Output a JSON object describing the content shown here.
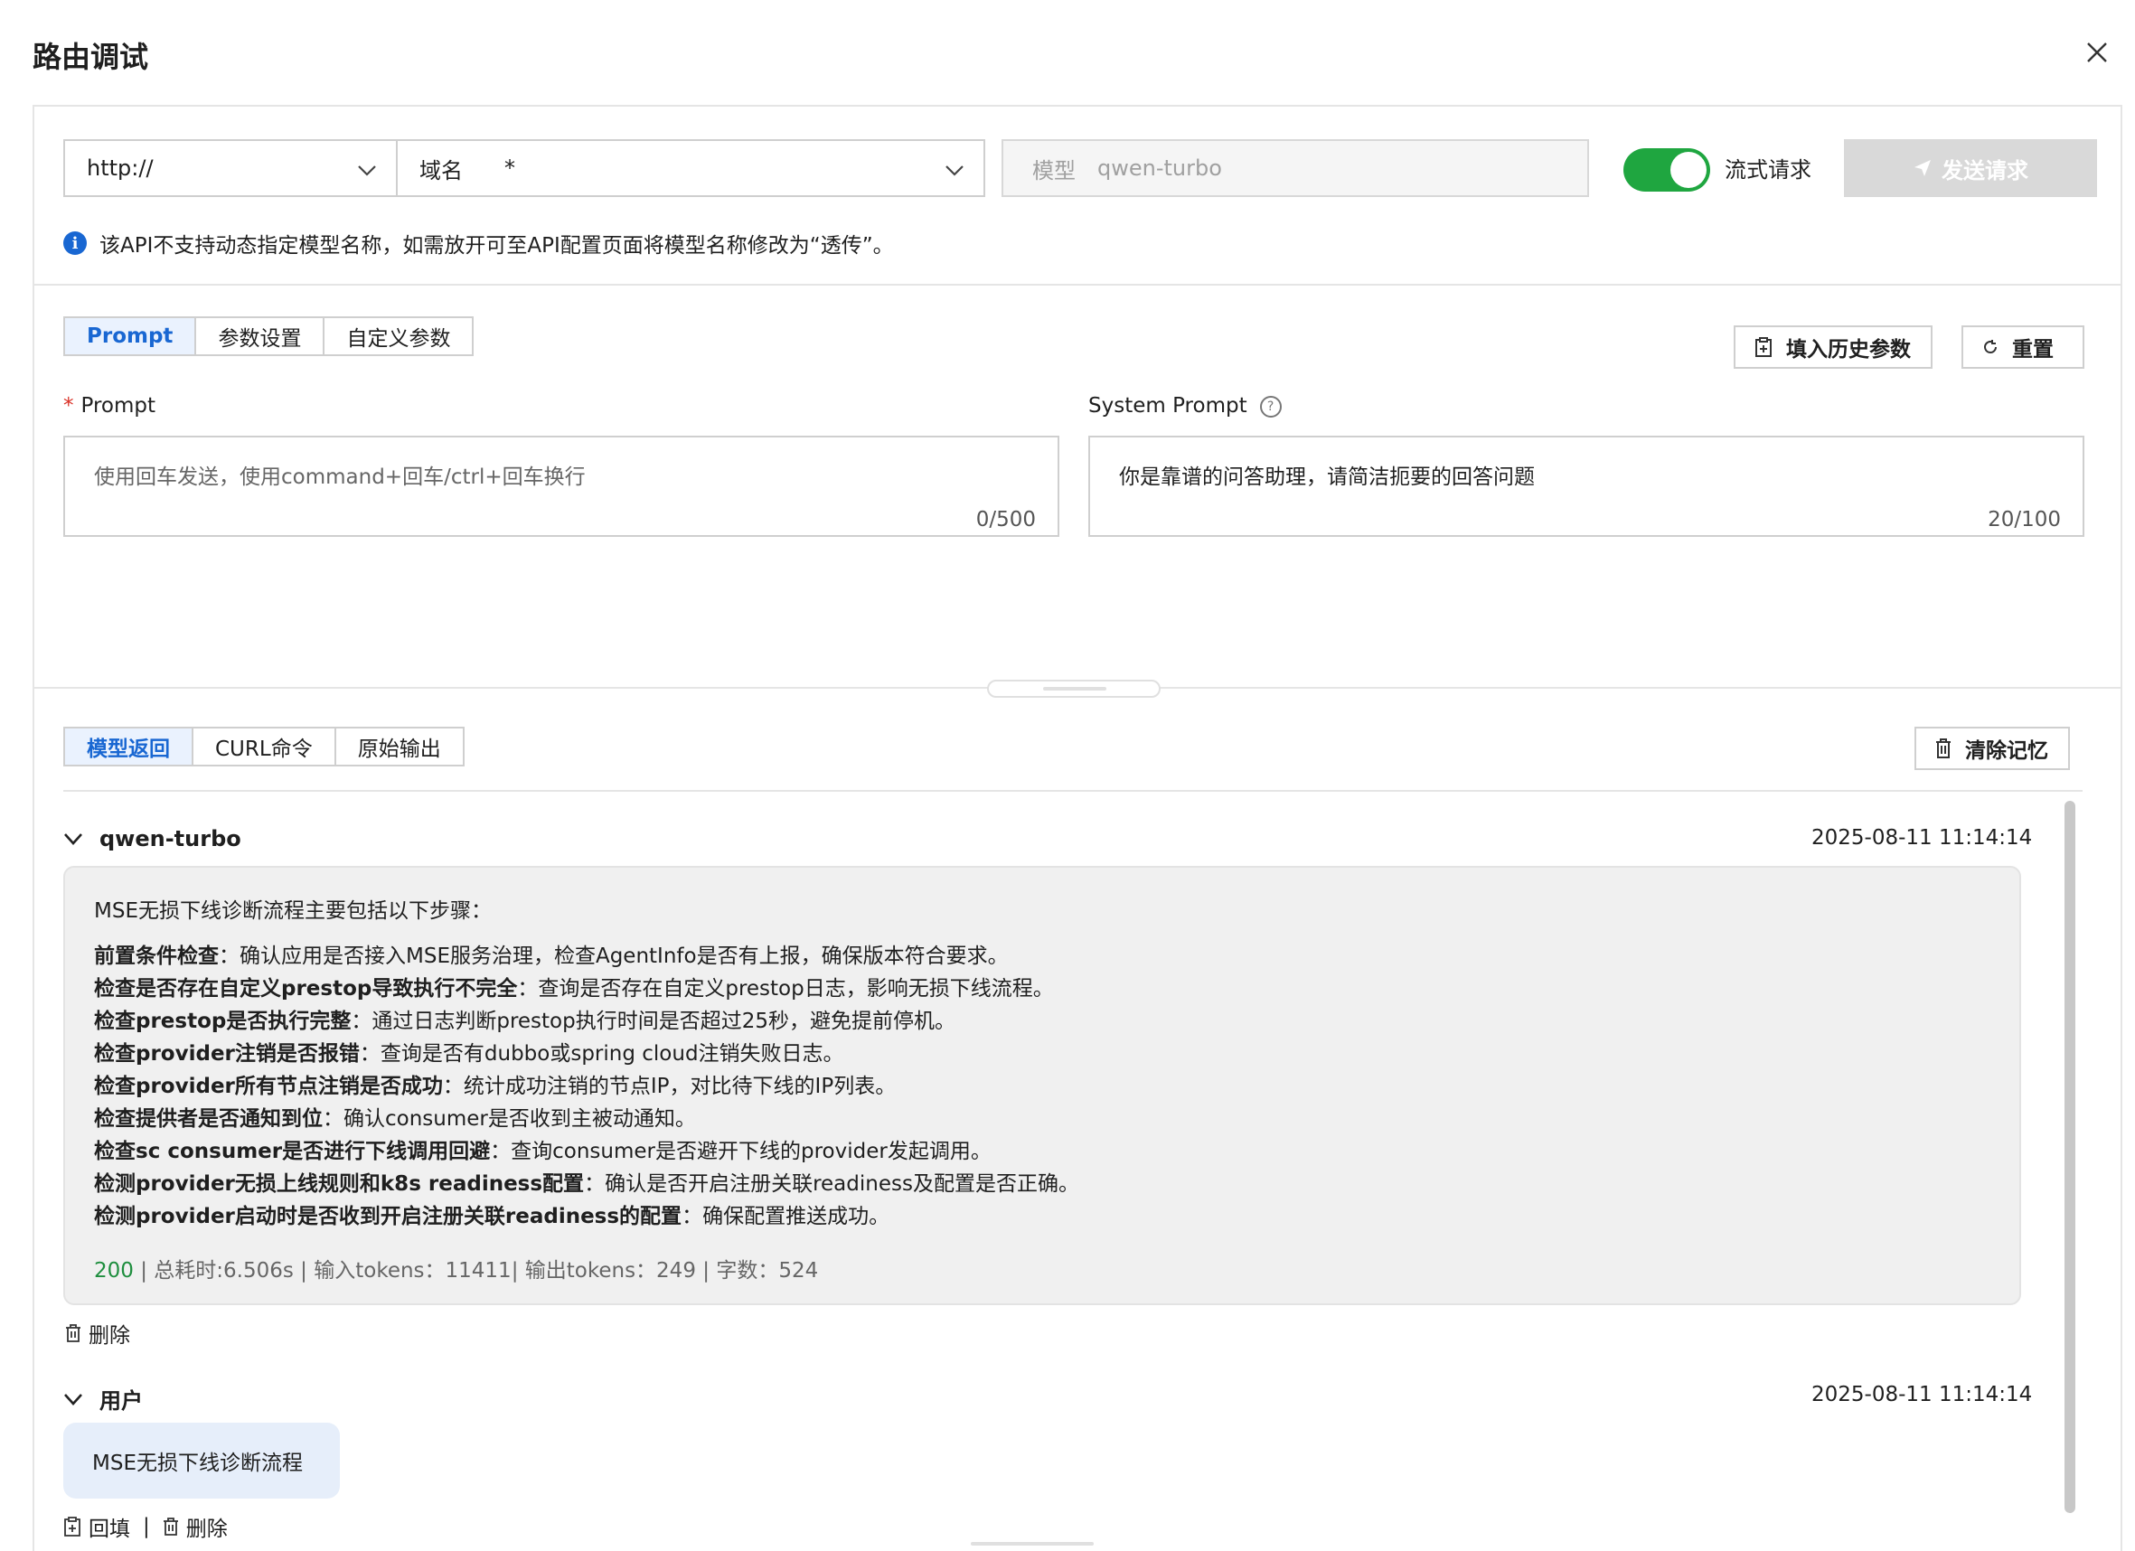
{
  "dialog": {
    "title": "路由调试"
  },
  "request": {
    "protocol": "http://",
    "domain_label": "域名",
    "domain_value": "*",
    "model_label": "模型",
    "model_value": "qwen-turbo",
    "stream_label": "流式请求",
    "send_label": "发送请求",
    "info_text": "该API不支持动态指定模型名称，如需放开可至API配置页面将模型名称修改为“透传”。"
  },
  "prompt_tabs": [
    "Prompt",
    "参数设置",
    "自定义参数"
  ],
  "actions": {
    "fill_history": "填入历史参数",
    "reset": "重置"
  },
  "prompt": {
    "label": "Prompt",
    "placeholder": "使用回车发送，使用command+回车/ctrl+回车换行",
    "count": "0/500"
  },
  "system_prompt": {
    "label": "System Prompt",
    "value": "你是靠谱的问答助理，请简洁扼要的回答问题",
    "count": "20/100"
  },
  "output_tabs": [
    "模型返回",
    "CURL命令",
    "原始输出"
  ],
  "clear_memory": "清除记忆",
  "response": {
    "model": "qwen-turbo",
    "time": "2025-08-11 11:14:14",
    "intro": "MSE无损下线诊断流程主要包括以下步骤：",
    "steps": [
      {
        "title": "前置条件检查",
        "desc": "：确认应用是否接入MSE服务治理，检查AgentInfo是否有上报，确保版本符合要求。"
      },
      {
        "title": "检查是否存在自定义prestop导致执行不完全",
        "desc": "：查询是否存在自定义prestop日志，影响无损下线流程。"
      },
      {
        "title": "检查prestop是否执行完整",
        "desc": "：通过日志判断prestop执行时间是否超过25秒，避免提前停机。"
      },
      {
        "title": "检查provider注销是否报错",
        "desc": "：查询是否有dubbo或spring cloud注销失败日志。"
      },
      {
        "title": "检查provider所有节点注销是否成功",
        "desc": "：统计成功注销的节点IP，对比待下线的IP列表。"
      },
      {
        "title": "检查提供者是否通知到位",
        "desc": "：确认consumer是否收到主被动通知。"
      },
      {
        "title": "检查sc consumer是否进行下线调用回避",
        "desc": "：查询consumer是否避开下线的provider发起调用。"
      },
      {
        "title": "检测provider无损上线规则和k8s readiness配置",
        "desc": "：确认是否开启注册关联readiness及配置是否正确。"
      },
      {
        "title": "检测provider启动时是否收到开启注册关联readiness的配置",
        "desc": "：确保配置推送成功。"
      }
    ],
    "status": "200",
    "stats": " | 总耗时:6.506s | 输入tokens：11411| 输出tokens：249 | 字数：524",
    "delete_label": "删除"
  },
  "user_message": {
    "label": "用户",
    "time": "2025-08-11 11:14:14",
    "text": "MSE无损下线诊断流程",
    "refill_label": "回填",
    "separator": "|",
    "delete_label": "删除"
  },
  "colors": {
    "accent": "#1967d2",
    "toggle_on": "#1fa640",
    "success": "#1e8e3e",
    "required": "#d93026"
  }
}
